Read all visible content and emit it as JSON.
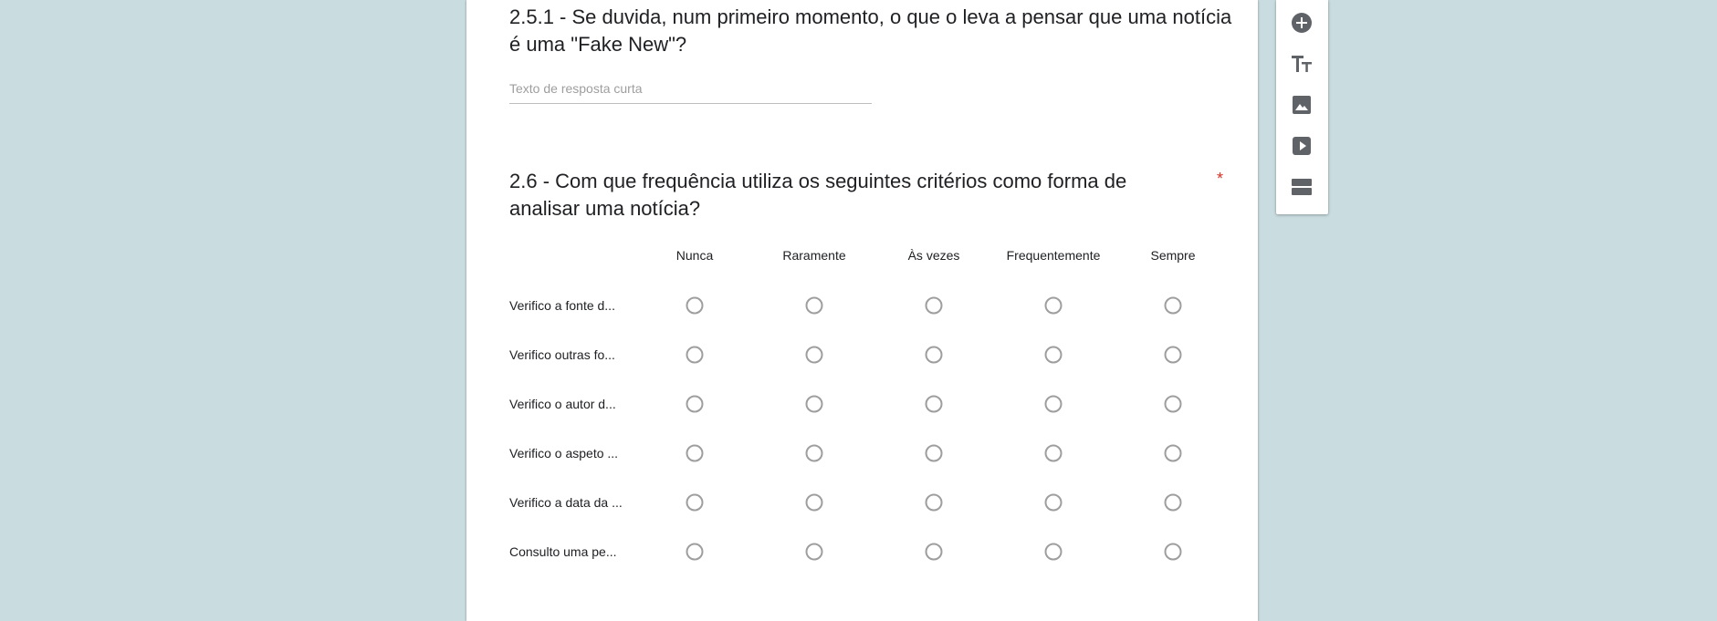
{
  "question_1": {
    "title": "2.5.1 - Se duvida, num primeiro momento, o que o leva a pensar que uma notícia é uma \"Fake New\"?",
    "placeholder": "Texto de resposta curta"
  },
  "question_2": {
    "title": "2.6 - Com que frequência utiliza os seguintes critérios como forma de analisar uma notícia?",
    "required_mark": "*",
    "columns": [
      "Nunca",
      "Raramente",
      "Às vezes",
      "Frequentemente",
      "Sempre"
    ],
    "rows": [
      "Verifico a fonte d...",
      "Verifico outras fo...",
      "Verifico o autor d...",
      "Verifico o aspeto ...",
      "Verifico a data da ...",
      "Consulto uma pe..."
    ]
  },
  "toolbar": {
    "items": [
      {
        "icon": "add-question-icon"
      },
      {
        "icon": "title-text-icon"
      },
      {
        "icon": "image-icon"
      },
      {
        "icon": "video-icon"
      },
      {
        "icon": "section-icon"
      }
    ]
  },
  "colors": {
    "background": "#c9dce0",
    "required": "#d93025",
    "icon": "#5f6368"
  }
}
